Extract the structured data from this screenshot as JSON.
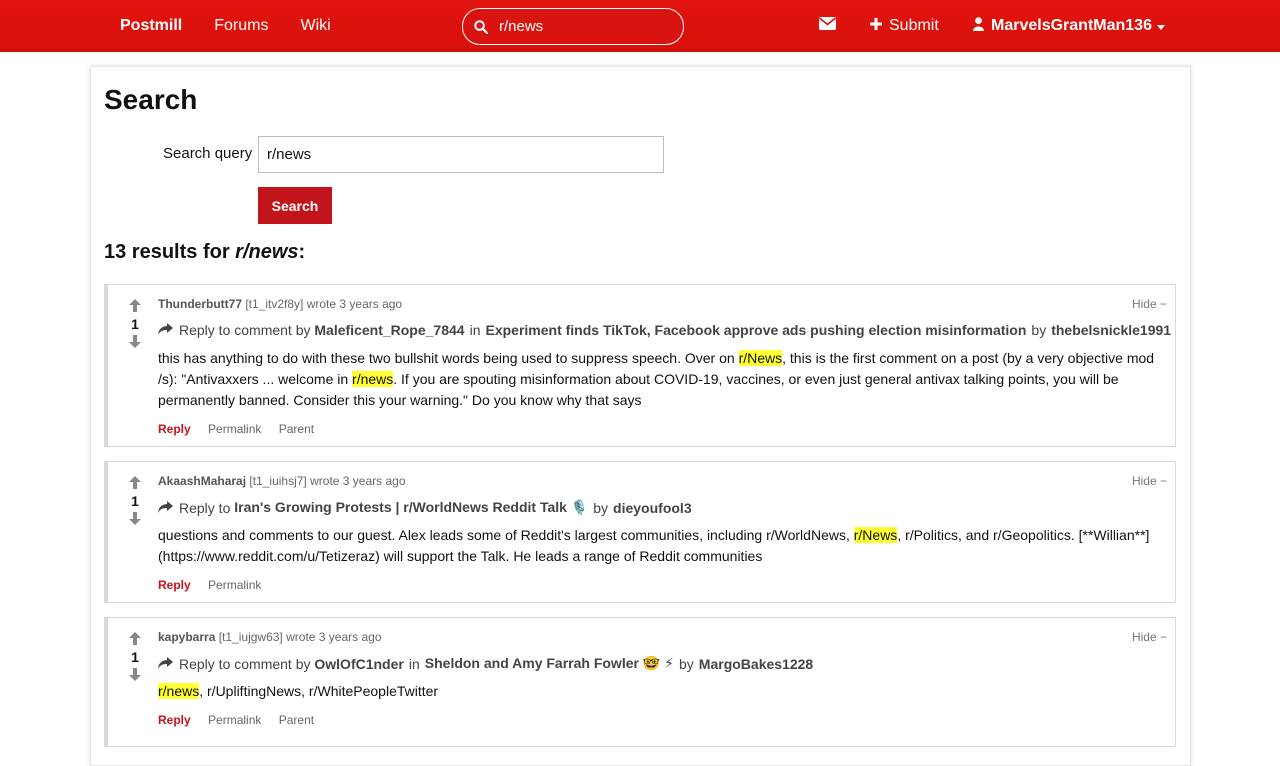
{
  "nav": {
    "brand": "Postmill",
    "forums": "Forums",
    "wiki": "Wiki",
    "search_value": "r/news",
    "submit": "Submit",
    "user": "MarvelsGrantMan136"
  },
  "page": {
    "title": "Search",
    "query_label": "Search query",
    "query_value": "r/news",
    "search_button": "Search",
    "results_count": "13 results for",
    "results_query": "r/news",
    "results_colon": ":"
  },
  "comments": [
    {
      "score": "1",
      "author": "Thunderbutt77",
      "id": "[t1_itv2f8y]",
      "wrote": "wrote 3 years ago",
      "hide": "Hide −",
      "reply_prefix": "Reply to comment by",
      "reply_user": "Maleficent_Rope_7844",
      "in": "in",
      "thread": "Experiment finds TikTok, Facebook approve ads pushing election misinformation",
      "by": "by",
      "op": "thebelsnickle1991",
      "body_1": "this has anything to do with these two bullshit words being used to suppress speech. Over on ",
      "mark_1": "r/News",
      "body_2": ", this is the first comment on a post (by a very objective mod /s): \"Antivaxxers ... welcome in ",
      "mark_2": "r/news",
      "body_3": ". If you are spouting misinformation about COVID-19, vaccines, or even just general antivax talking points, you will be permanently banned. Consider this your warning.\" Do you know why that says",
      "reply": "Reply",
      "permalink": "Permalink",
      "parent": "Parent"
    },
    {
      "score": "1",
      "author": "AkaashMaharaj",
      "id": "[t1_iuihsj7]",
      "wrote": "wrote 3 years ago",
      "hide": "Hide −",
      "reply_prefix": "Reply to",
      "thread": "Iran's Growing Protests | r/WorldNews Reddit Talk 🎙️",
      "by": "by",
      "op": "dieyoufool3",
      "body_1": "questions and comments to our guest. Alex leads some of Reddit's largest communities, including r/WorldNews, ",
      "mark_1": "r/News",
      "body_2": ", r/Politics, and r/Geopolitics. [**Willian**](https://www.reddit.com/u/Tetizeraz) will support the Talk. He leads a range of Reddit communities",
      "reply": "Reply",
      "permalink": "Permalink"
    },
    {
      "score": "1",
      "author": "kapybarra",
      "id": "[t1_iujgw63]",
      "wrote": "wrote 3 years ago",
      "hide": "Hide −",
      "reply_prefix": "Reply to comment by",
      "reply_user": "OwlOfC1nder",
      "in": "in",
      "thread": "Sheldon and Amy Farrah Fowler 🤓 ⚡",
      "by": "by",
      "op": "MargoBakes1228",
      "mark_1": "r/news",
      "body_1": ", r/UpliftingNews, r/WhitePeopleTwitter",
      "reply": "Reply",
      "permalink": "Permalink",
      "parent": "Parent"
    }
  ]
}
